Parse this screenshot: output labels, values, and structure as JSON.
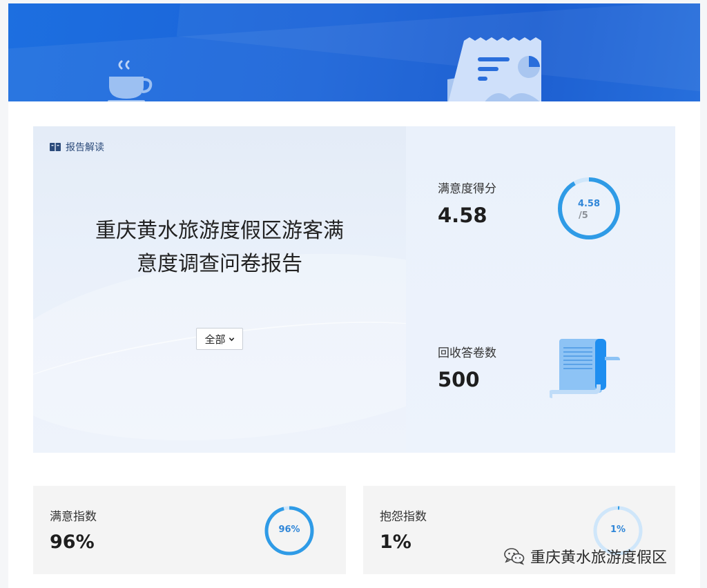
{
  "hero": {
    "tag": "报告解读",
    "title_line1": "重庆黄水旅游度假区游客满",
    "title_line2": "意度调查问卷报告",
    "filter_selected": "全部"
  },
  "satisfaction_score": {
    "label": "满意度得分",
    "value": "4.58",
    "ring_value": "4.58",
    "ring_max": "/5",
    "fraction": 0.916
  },
  "responses": {
    "label": "回收答卷数",
    "value": "500"
  },
  "satisfaction_index": {
    "label": "满意指数",
    "value": "96%",
    "ring_text": "96%",
    "fraction": 0.96
  },
  "complaint_index": {
    "label": "抱怨指数",
    "value": "1%",
    "ring_text": "1%",
    "fraction": 0.01
  },
  "watermark": {
    "text": "重庆黄水旅游度假区"
  },
  "colors": {
    "banner": "#1a63d8",
    "ring": "#2f9be6",
    "ring_track": "#cfe6fa"
  },
  "icons": [
    "coffee-cup-icon",
    "report-document-icon",
    "book-icon",
    "chevron-down-icon",
    "scroll-document-icon",
    "wechat-icon"
  ]
}
